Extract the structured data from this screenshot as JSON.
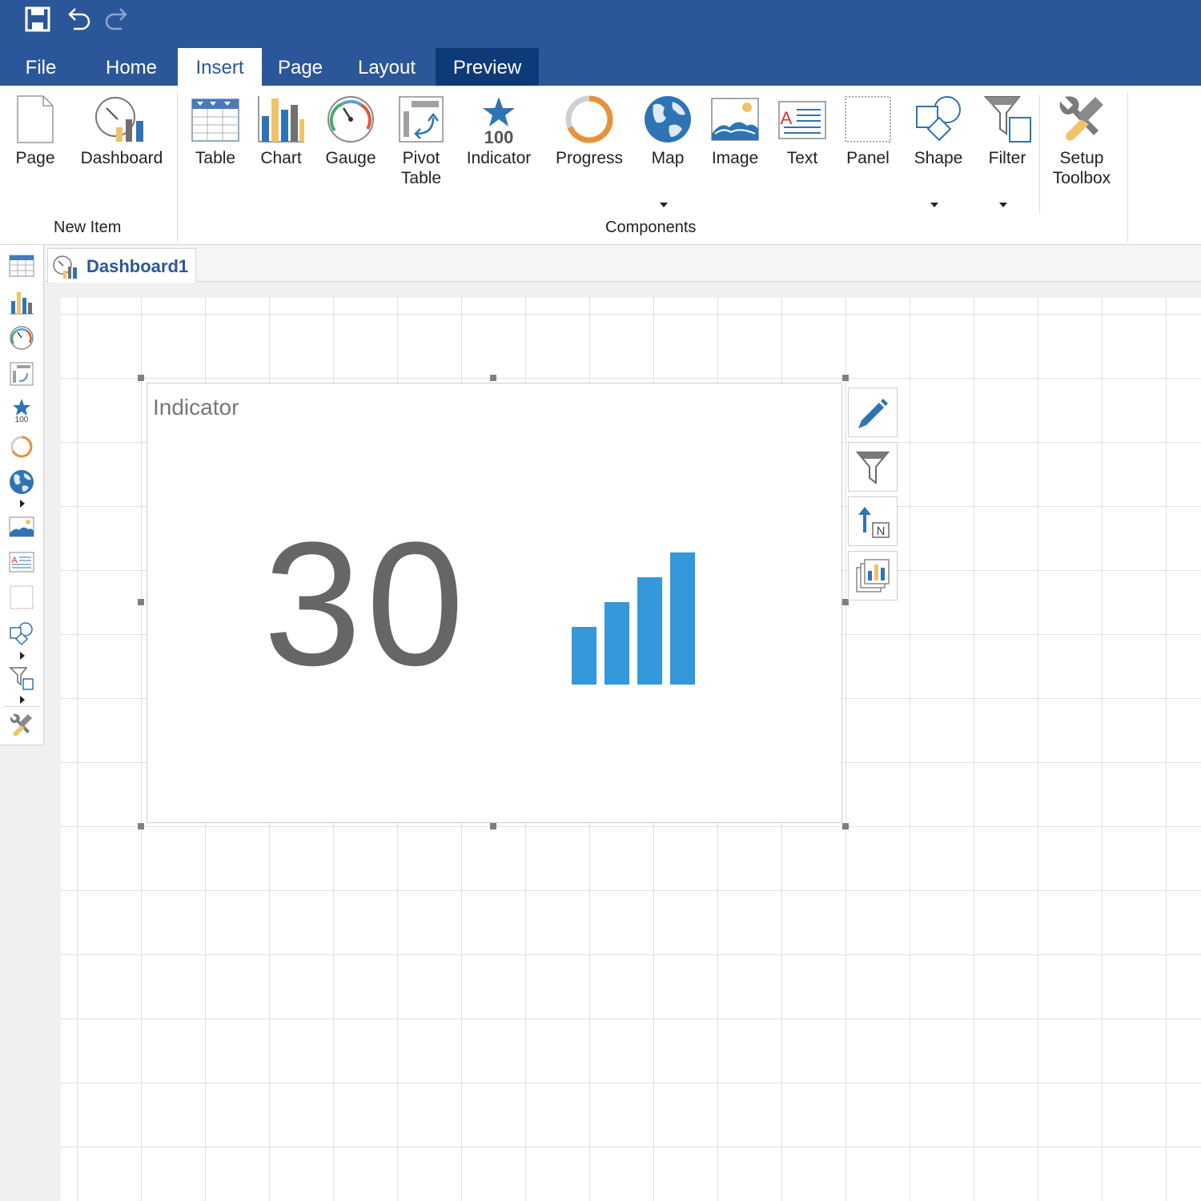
{
  "quick_access": {
    "save_icon": "save-icon",
    "undo_icon": "undo-icon",
    "redo_icon": "redo-icon"
  },
  "tabs": [
    {
      "label": "File"
    },
    {
      "label": "Home"
    },
    {
      "label": "Insert",
      "active": true
    },
    {
      "label": "Page"
    },
    {
      "label": "Layout"
    },
    {
      "label": "Preview"
    }
  ],
  "ribbon": {
    "new_item": {
      "group_label": "New Item",
      "buttons": [
        {
          "label": "Page",
          "icon": "page-icon"
        },
        {
          "label": "Dashboard",
          "icon": "dashboard-icon"
        }
      ]
    },
    "components": {
      "group_label": "Components",
      "buttons": [
        {
          "label": "Table",
          "icon": "table-icon"
        },
        {
          "label": "Chart",
          "icon": "chart-icon"
        },
        {
          "label": "Gauge",
          "icon": "gauge-icon"
        },
        {
          "label": "Pivot",
          "label2": "Table",
          "icon": "pivot-table-icon"
        },
        {
          "label": "Indicator",
          "icon": "indicator-icon",
          "icon_text": "100"
        },
        {
          "label": "Progress",
          "icon": "progress-icon"
        },
        {
          "label": "Map",
          "icon": "map-icon",
          "dropdown": true
        },
        {
          "label": "Image",
          "icon": "image-icon"
        },
        {
          "label": "Text",
          "icon": "text-icon",
          "icon_text": "A"
        },
        {
          "label": "Panel",
          "icon": "panel-icon"
        },
        {
          "label": "Shape",
          "icon": "shape-icon",
          "dropdown": true
        },
        {
          "label": "Filter",
          "icon": "filter-icon",
          "dropdown": true
        }
      ]
    },
    "setup": {
      "label": "Setup",
      "label2": "Toolbox",
      "icon": "setup-toolbox-icon"
    }
  },
  "toolbox": {
    "items": [
      "table-icon",
      "chart-icon",
      "gauge-icon",
      "pivot-table-icon",
      "indicator-icon",
      "progress-icon",
      "map-icon",
      "image-icon",
      "text-icon",
      "panel-icon",
      "shape-icon",
      "filter-icon",
      "setup-toolbox-icon"
    ],
    "indicator_text": "100",
    "text_icon_letter": "A"
  },
  "document_tab": {
    "label": "Dashboard1",
    "icon": "dashboard-icon"
  },
  "indicator_widget": {
    "title": "Indicator",
    "value": "30",
    "icon": "signal-bars-icon",
    "color": "#3498db"
  },
  "side_actions": [
    {
      "icon": "edit-pencil-icon"
    },
    {
      "icon": "filter-icon"
    },
    {
      "icon": "sort-icon",
      "icon_text": "N"
    },
    {
      "icon": "change-type-icon"
    }
  ],
  "colors": {
    "ribbon_blue": "#2b579a",
    "preview_tab": "#0f3a78",
    "accent_blue": "#3498db",
    "orange": "#e8913a",
    "yellow": "#f0c36a"
  }
}
